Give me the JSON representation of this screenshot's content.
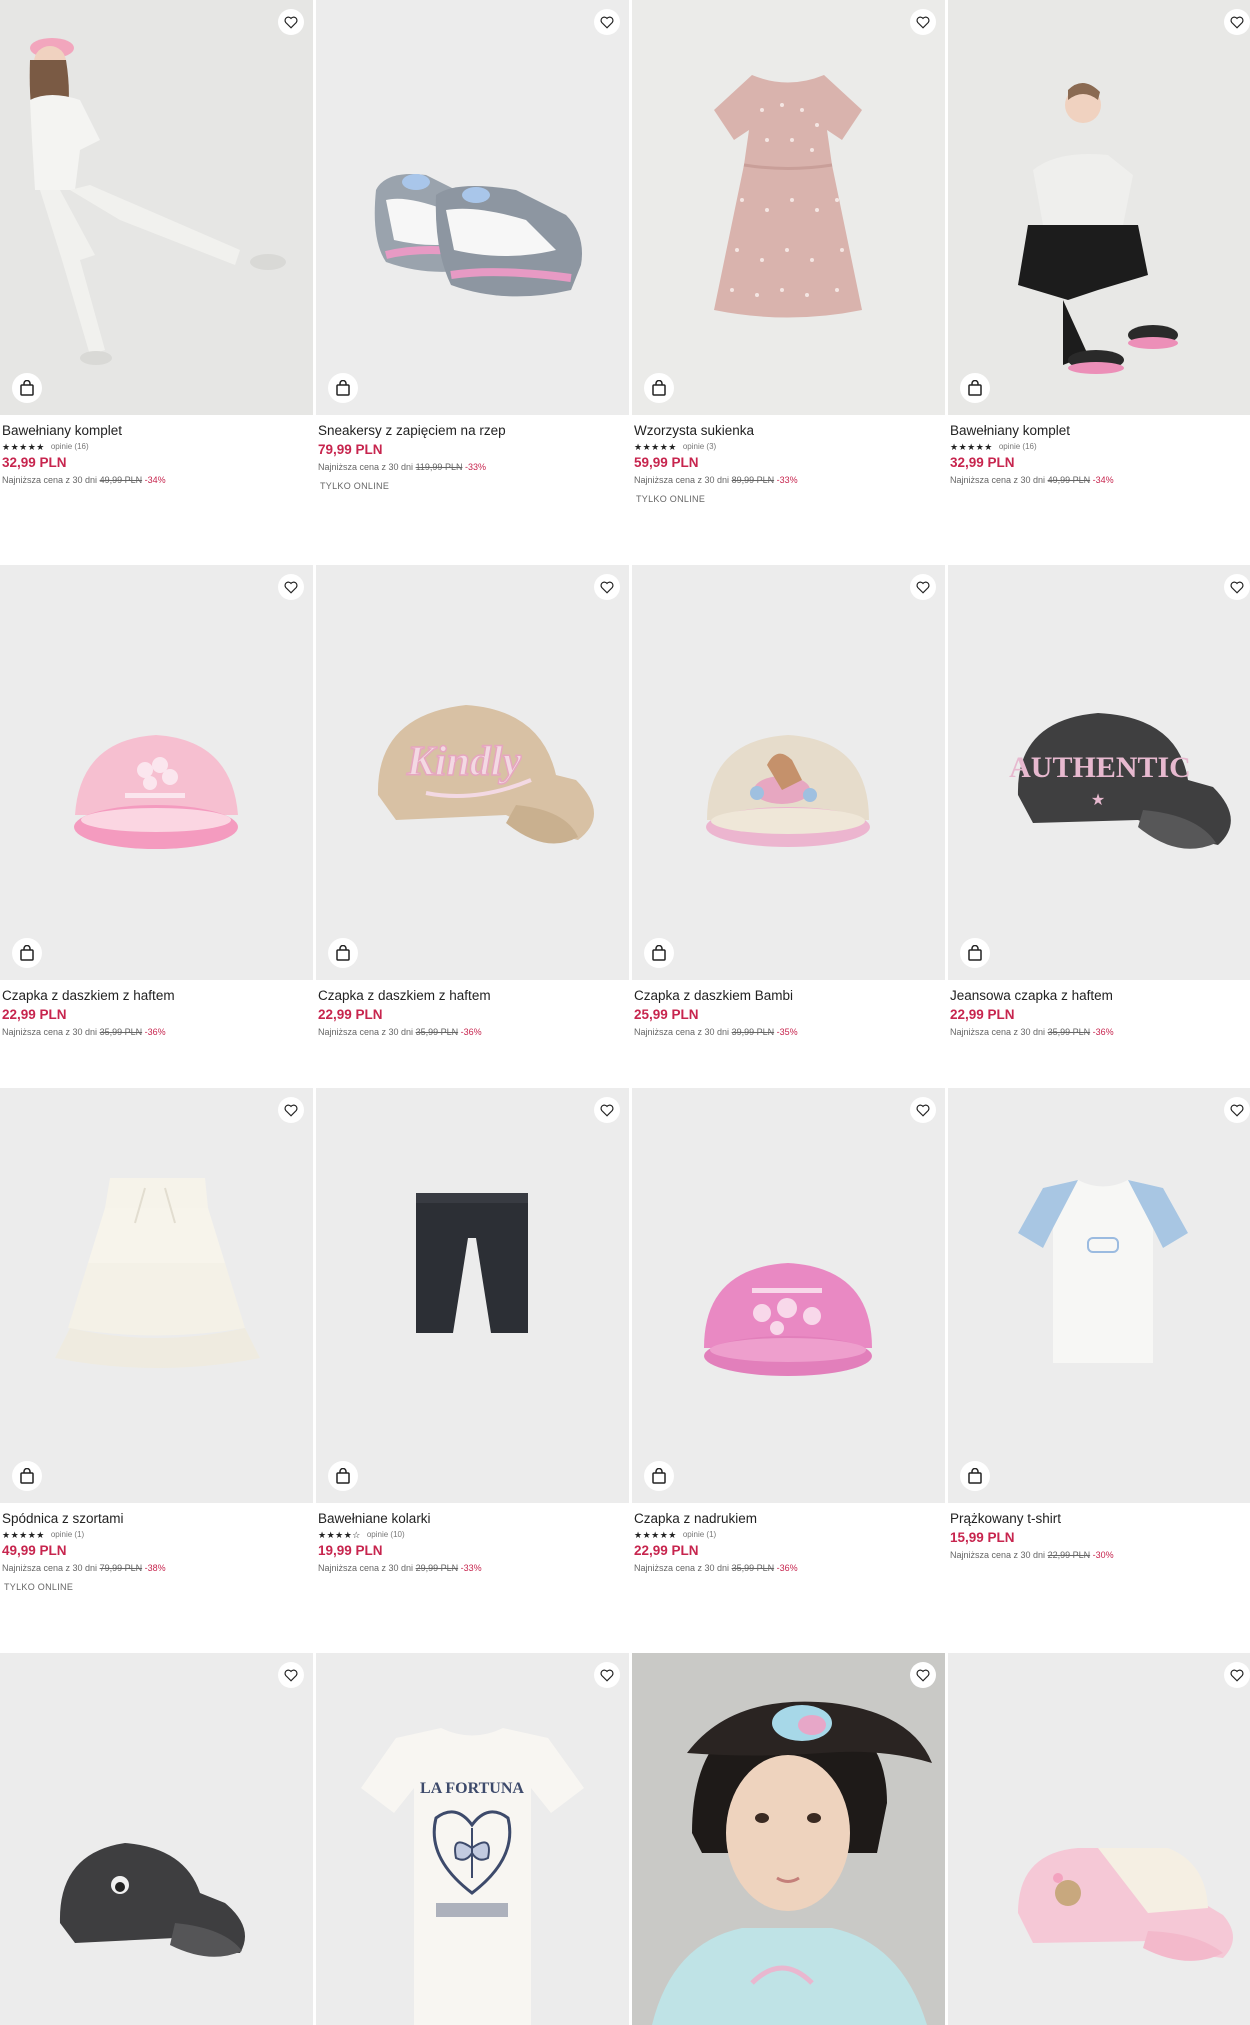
{
  "lowest_prefix": "Najniższa cena z 30 dni",
  "products": [
    {
      "name": "Bawełniany komplet",
      "stars": "★★★★★",
      "reviews": "opinie (16)",
      "price": "32,99 PLN",
      "old_price": "49,99 PLN",
      "discount": "-34%",
      "badge": ""
    },
    {
      "name": "Sneakersy z zapięciem na rzep",
      "stars": "",
      "reviews": "",
      "price": "79,99 PLN",
      "old_price": "119,99 PLN",
      "discount": "-33%",
      "badge": "TYLKO ONLINE"
    },
    {
      "name": "Wzorzysta sukienka",
      "stars": "★★★★★",
      "reviews": "opinie (3)",
      "price": "59,99 PLN",
      "old_price": "89,99 PLN",
      "discount": "-33%",
      "badge": "TYLKO ONLINE"
    },
    {
      "name": "Bawełniany komplet",
      "stars": "★★★★★",
      "reviews": "opinie (16)",
      "price": "32,99 PLN",
      "old_price": "49,99 PLN",
      "discount": "-34%",
      "badge": ""
    },
    {
      "name": "Czapka z daszkiem z haftem",
      "stars": "",
      "reviews": "",
      "price": "22,99 PLN",
      "old_price": "35,99 PLN",
      "discount": "-36%",
      "badge": ""
    },
    {
      "name": "Czapka z daszkiem z haftem",
      "stars": "",
      "reviews": "",
      "price": "22,99 PLN",
      "old_price": "35,99 PLN",
      "discount": "-36%",
      "badge": ""
    },
    {
      "name": "Czapka z daszkiem Bambi",
      "stars": "",
      "reviews": "",
      "price": "25,99 PLN",
      "old_price": "39,99 PLN",
      "discount": "-35%",
      "badge": ""
    },
    {
      "name": "Jeansowa czapka z haftem",
      "stars": "",
      "reviews": "",
      "price": "22,99 PLN",
      "old_price": "35,99 PLN",
      "discount": "-36%",
      "badge": ""
    },
    {
      "name": "Spódnica z szortami",
      "stars": "★★★★★",
      "reviews": "opinie (1)",
      "price": "49,99 PLN",
      "old_price": "79,99 PLN",
      "discount": "-38%",
      "badge": "TYLKO ONLINE"
    },
    {
      "name": "Bawełniane kolarki",
      "stars": "★★★★☆",
      "reviews": "opinie (10)",
      "price": "19,99 PLN",
      "old_price": "29,99 PLN",
      "discount": "-33%",
      "badge": ""
    },
    {
      "name": "Czapka z nadrukiem",
      "stars": "★★★★★",
      "reviews": "opinie (1)",
      "price": "22,99 PLN",
      "old_price": "35,99 PLN",
      "discount": "-36%",
      "badge": ""
    },
    {
      "name": "Prążkowany t-shirt",
      "stars": "",
      "reviews": "",
      "price": "15,99 PLN",
      "old_price": "22,99 PLN",
      "discount": "-30%",
      "badge": ""
    },
    {
      "name": "",
      "image_text": "",
      "stars": "",
      "reviews": "",
      "price": "",
      "old_price": "",
      "discount": "",
      "badge": ""
    },
    {
      "name": "",
      "image_text": "LA FORTUNA",
      "stars": "",
      "reviews": "",
      "price": "",
      "old_price": "",
      "discount": "",
      "badge": ""
    },
    {
      "name": "",
      "image_text": "",
      "stars": "",
      "reviews": "",
      "price": "",
      "old_price": "",
      "discount": "",
      "badge": ""
    },
    {
      "name": "",
      "image_text": "",
      "stars": "",
      "reviews": "",
      "price": "",
      "old_price": "",
      "discount": "",
      "badge": ""
    }
  ],
  "image_texts": {
    "cap_kindly": "Kindly",
    "cap_authentic": "AUTHENTIC",
    "tee_fortuna": "LA FORTUNA"
  },
  "icons": {
    "favorite": "heart-icon",
    "cart": "shopping-bag-icon"
  },
  "colors": {
    "price": "#c7254e",
    "discount": "#c7254e",
    "image_bg": "#ececec"
  }
}
